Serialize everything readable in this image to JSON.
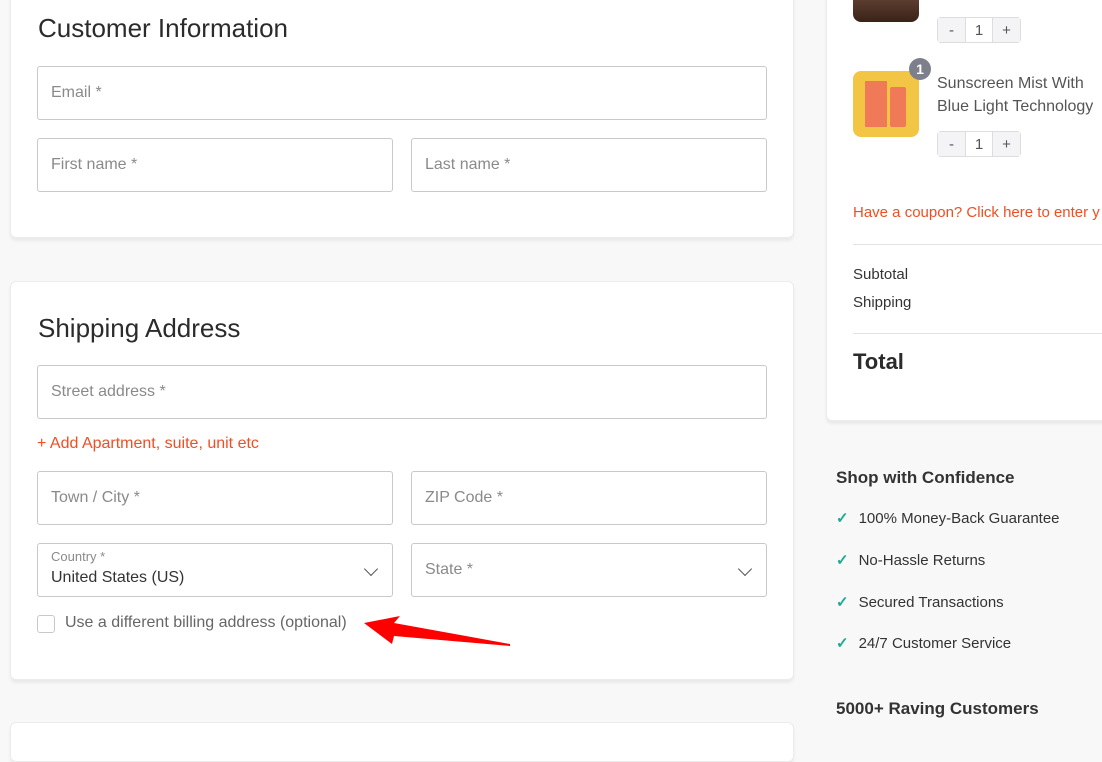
{
  "customer": {
    "title": "Customer Information",
    "email": "Email *",
    "first_name": "First name *",
    "last_name": "Last name *"
  },
  "shipping": {
    "title": "Shipping Address",
    "street": "Street address *",
    "add_apartment": "+ Add Apartment, suite, unit etc",
    "city": "Town / City *",
    "zip": "ZIP Code *",
    "country_label": "Country *",
    "country_value": "United States (US)",
    "state": "State *",
    "billing_checkbox": "Use a different billing address (optional)",
    "billing_checked": false
  },
  "cart": {
    "items": [
      {
        "name": "",
        "qty": "1"
      },
      {
        "name": "Sunscreen Mist With Blue Light Technology",
        "qty": "1",
        "badge": "1"
      }
    ],
    "minus": "-",
    "plus": "+",
    "coupon": "Have a coupon? Click here to enter y",
    "subtotal": "Subtotal",
    "shipping": "Shipping",
    "total": "Total"
  },
  "confidence": {
    "title": "Shop with Confidence",
    "items": [
      "100% Money-Back Guarantee",
      "No-Hassle Returns",
      "Secured Transactions",
      "24/7 Customer Service"
    ]
  },
  "customers_title": "5000+ Raving Customers",
  "colors": {
    "accent": "#f04e23",
    "check": "#1fa894",
    "annotation_arrow": "#ff0000"
  }
}
